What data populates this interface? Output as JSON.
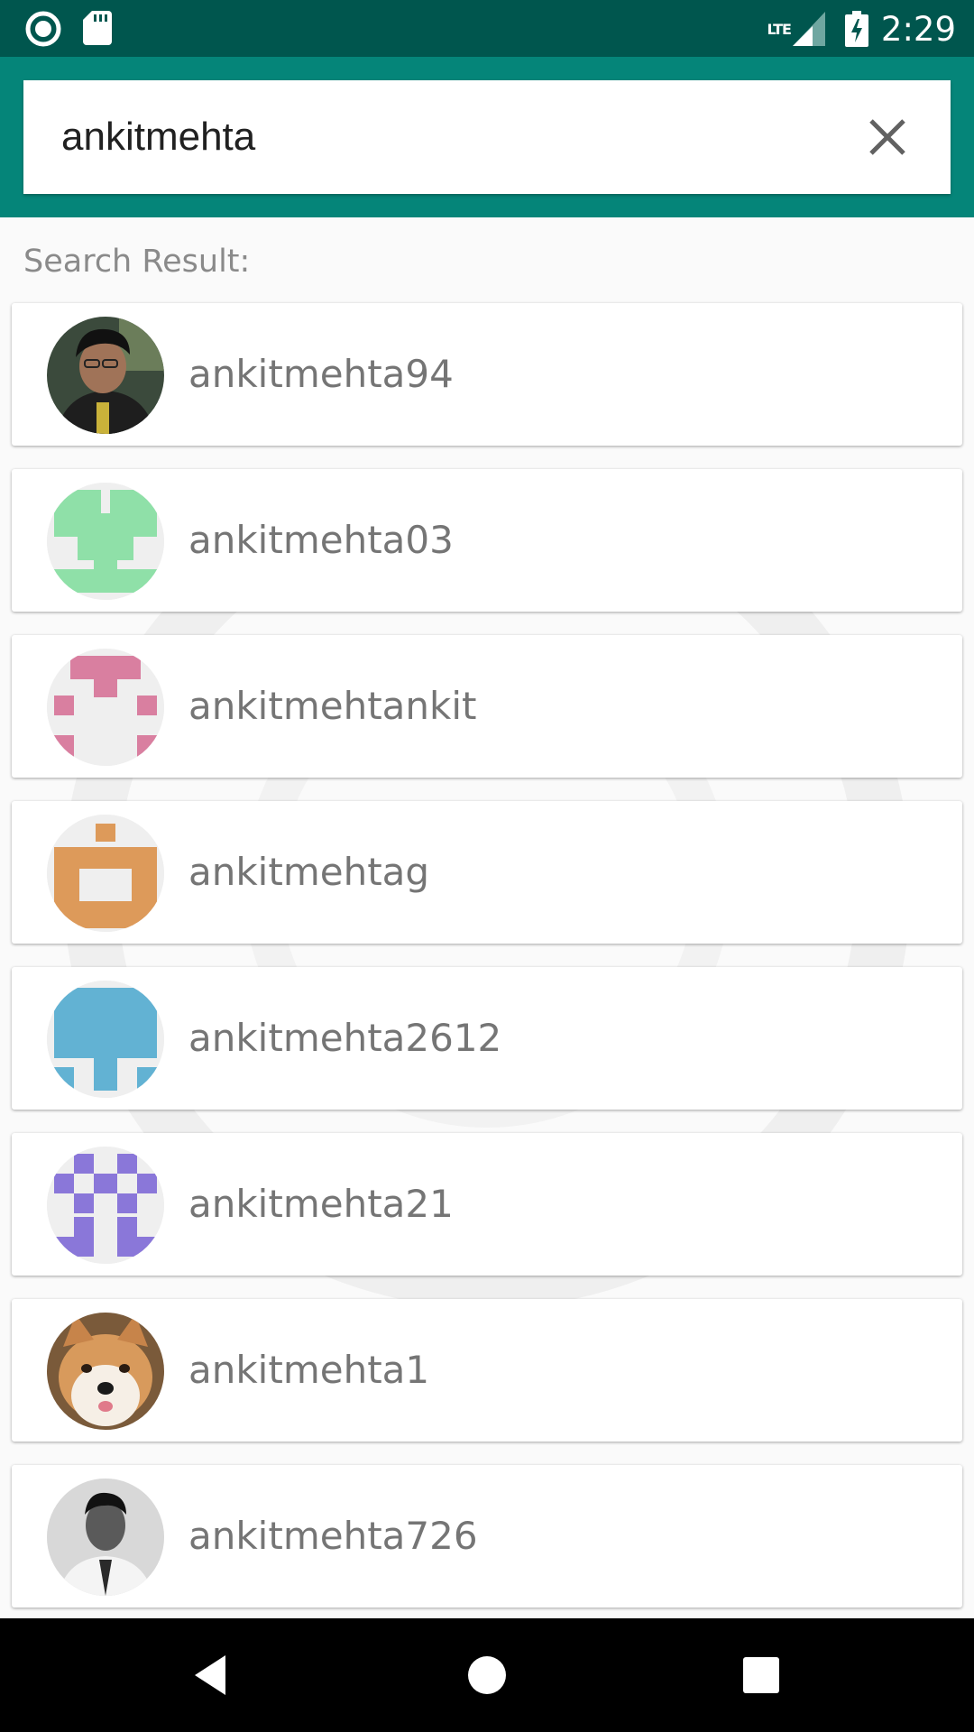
{
  "status_bar": {
    "time": "2:29",
    "network": "LTE",
    "icons": [
      "record-icon",
      "sd-card-icon",
      "lte-signal-icon",
      "battery-charging-icon"
    ]
  },
  "search": {
    "value": "ankitmehta",
    "placeholder": "",
    "clear_icon": "close-icon"
  },
  "results_label": "Search Result:",
  "results": [
    {
      "username": "ankitmehta94",
      "avatar": "photo-person-glasses"
    },
    {
      "username": "ankitmehta03",
      "avatar": "identicon",
      "color": "#8fe0a8"
    },
    {
      "username": "ankitmehtankit",
      "avatar": "identicon",
      "color": "#d97fa0"
    },
    {
      "username": "ankitmehtag",
      "avatar": "identicon",
      "color": "#dd9a5a"
    },
    {
      "username": "ankitmehta2612",
      "avatar": "identicon",
      "color": "#62b2d3"
    },
    {
      "username": "ankitmehta21",
      "avatar": "identicon",
      "color": "#8a77d9"
    },
    {
      "username": "ankitmehta1",
      "avatar": "photo-shiba-dog"
    },
    {
      "username": "ankitmehta726",
      "avatar": "photo-person-bw"
    }
  ],
  "nav_bar": {
    "icons": [
      "back-icon",
      "home-icon",
      "recents-icon"
    ]
  },
  "colors": {
    "status_bar": "#00564e",
    "app_bar": "#058579",
    "background": "#fafafa"
  }
}
